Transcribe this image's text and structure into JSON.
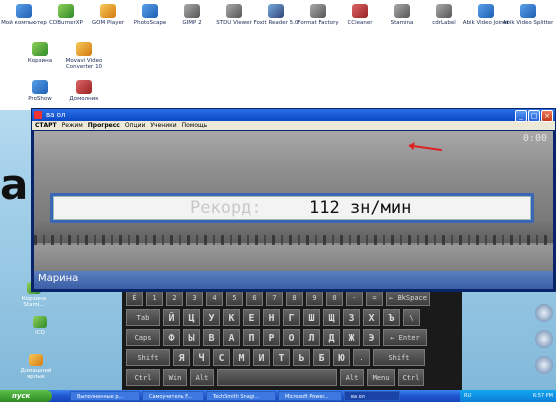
{
  "desktop": {
    "top_icons": [
      {
        "label": "Мой компьютер",
        "icon": "computer-icon"
      },
      {
        "label": "CDBurnerXP",
        "icon": "disc-icon"
      },
      {
        "label": "GOM Player",
        "icon": "player-icon"
      },
      {
        "label": "PhotoScape",
        "icon": "photo-icon"
      },
      {
        "label": "GIMP 2",
        "icon": "gimp-icon"
      },
      {
        "label": "STDU Viewer",
        "icon": "viewer-icon"
      },
      {
        "label": "Foxit Reader 5.0",
        "icon": "pdf-icon"
      },
      {
        "label": "Format Factory",
        "icon": "factory-icon"
      },
      {
        "label": "CCleaner",
        "icon": "cleaner-icon"
      },
      {
        "label": "Stamina",
        "icon": "stamina-icon"
      },
      {
        "label": "cdrLabel",
        "icon": "label-icon"
      },
      {
        "label": "Abik Video Joiner",
        "icon": "video-icon"
      },
      {
        "label": "Abik Video Splitter",
        "icon": "video-icon"
      }
    ],
    "second_row": [
      {
        "label": "Корзина",
        "icon": "recycle-bin-icon"
      },
      {
        "label": "Movavi Video Converter 10",
        "icon": "converter-icon"
      }
    ],
    "third_row": [
      {
        "label": "ProShow",
        "icon": "proshow-icon"
      },
      {
        "label": "Домолник",
        "icon": "folder-icon"
      }
    ],
    "left_icons": [
      {
        "label": "Корзина Stami...",
        "icon": "shortcut-icon"
      },
      {
        "label": "ICQ",
        "icon": "icq-icon"
      },
      {
        "label": "Домашний ярлык",
        "icon": "shortcut-icon"
      }
    ],
    "big_letter": "a"
  },
  "window": {
    "title": "ва ол",
    "menu": [
      "СТАРТ",
      "Режим",
      "Прогресс",
      "Опции",
      "Ученики",
      "Помощь"
    ],
    "timer": "0:00",
    "record_label": "Рекорд:",
    "record_value": "112 зн/мин",
    "user_name": "Марина"
  },
  "keyboard": {
    "row1": [
      "Ё",
      "1",
      "2",
      "3",
      "4",
      "5",
      "6",
      "7",
      "8",
      "9",
      "0",
      "-",
      "=",
      "← BkSpace"
    ],
    "row2": [
      "Tab",
      "Й",
      "Ц",
      "У",
      "К",
      "Е",
      "Н",
      "Г",
      "Ш",
      "Щ",
      "З",
      "Х",
      "Ъ",
      "\\"
    ],
    "row3": [
      "Caps",
      "Ф",
      "Ы",
      "В",
      "А",
      "П",
      "Р",
      "О",
      "Л",
      "Д",
      "Ж",
      "Э",
      "← Enter"
    ],
    "row4": [
      "Shift",
      "Я",
      "Ч",
      "С",
      "М",
      "И",
      "Т",
      "Ь",
      "Б",
      "Ю",
      ".",
      "Shift"
    ],
    "row5": [
      "Ctrl",
      "Win",
      "Alt",
      "",
      "Alt",
      "Menu",
      "Ctrl"
    ]
  },
  "taskbar": {
    "start_label": "пуск",
    "tasks": [
      "Выполненные р...",
      "Самоучитель F...",
      "TechSmith Snagi...",
      "Microsoft Power...",
      "ва ол"
    ],
    "tray_lang": "RU",
    "clock": "6:57 PM"
  }
}
